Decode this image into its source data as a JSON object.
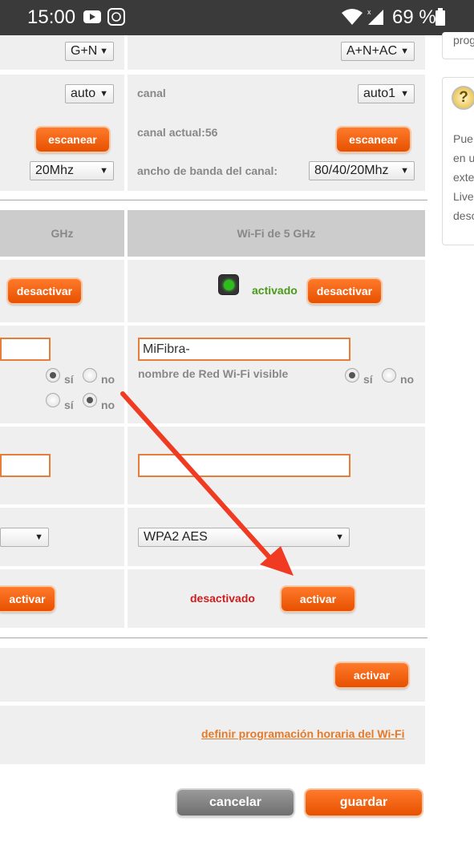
{
  "status_bar": {
    "time": "15:00",
    "battery_text": "69 %",
    "icons": [
      "youtube-icon",
      "app-notification-icon",
      "wifi-icon",
      "signal-icon",
      "battery-icon"
    ]
  },
  "radio_settings": {
    "mode_24": "G+N",
    "mode_5": "A+N+AC",
    "channel_label": "canal",
    "channel_24": "auto",
    "channel_5": "auto1",
    "current_channel_label": "canal actual:56",
    "scan_label": "escanear",
    "bandwidth_label": "ancho de banda del canal:",
    "bandwidth_24": "20Mhz",
    "bandwidth_5": "80/40/20Mhz"
  },
  "wifi_table": {
    "col_24_header": "GHz",
    "col_5_header": "Wi-Fi de 5 GHz",
    "status_5": "activado",
    "deactivate_label": "desactivar",
    "ssid_5": "MiFibra-",
    "visible_label": "nombre de Red Wi-Fi visible",
    "yes_label": "sí",
    "no_label": "no",
    "security_5": "WPA2 AES",
    "wps_status_5": "desactivado",
    "activate_label": "activar"
  },
  "schedule": {
    "activate_label": "activar",
    "schedule_link": "definir programación horaria del Wi-Fi"
  },
  "footer": {
    "cancel_label": "cancelar",
    "save_label": "guardar"
  },
  "side_panel": {
    "top_text": "prog",
    "help_lines": [
      "Pue",
      "en u",
      "exte",
      "Live",
      "desc"
    ]
  },
  "colors": {
    "accent": "#e65100",
    "status_on": "#4a9a1a",
    "status_off": "#cc1e1e",
    "arrow": "#f03a22"
  }
}
